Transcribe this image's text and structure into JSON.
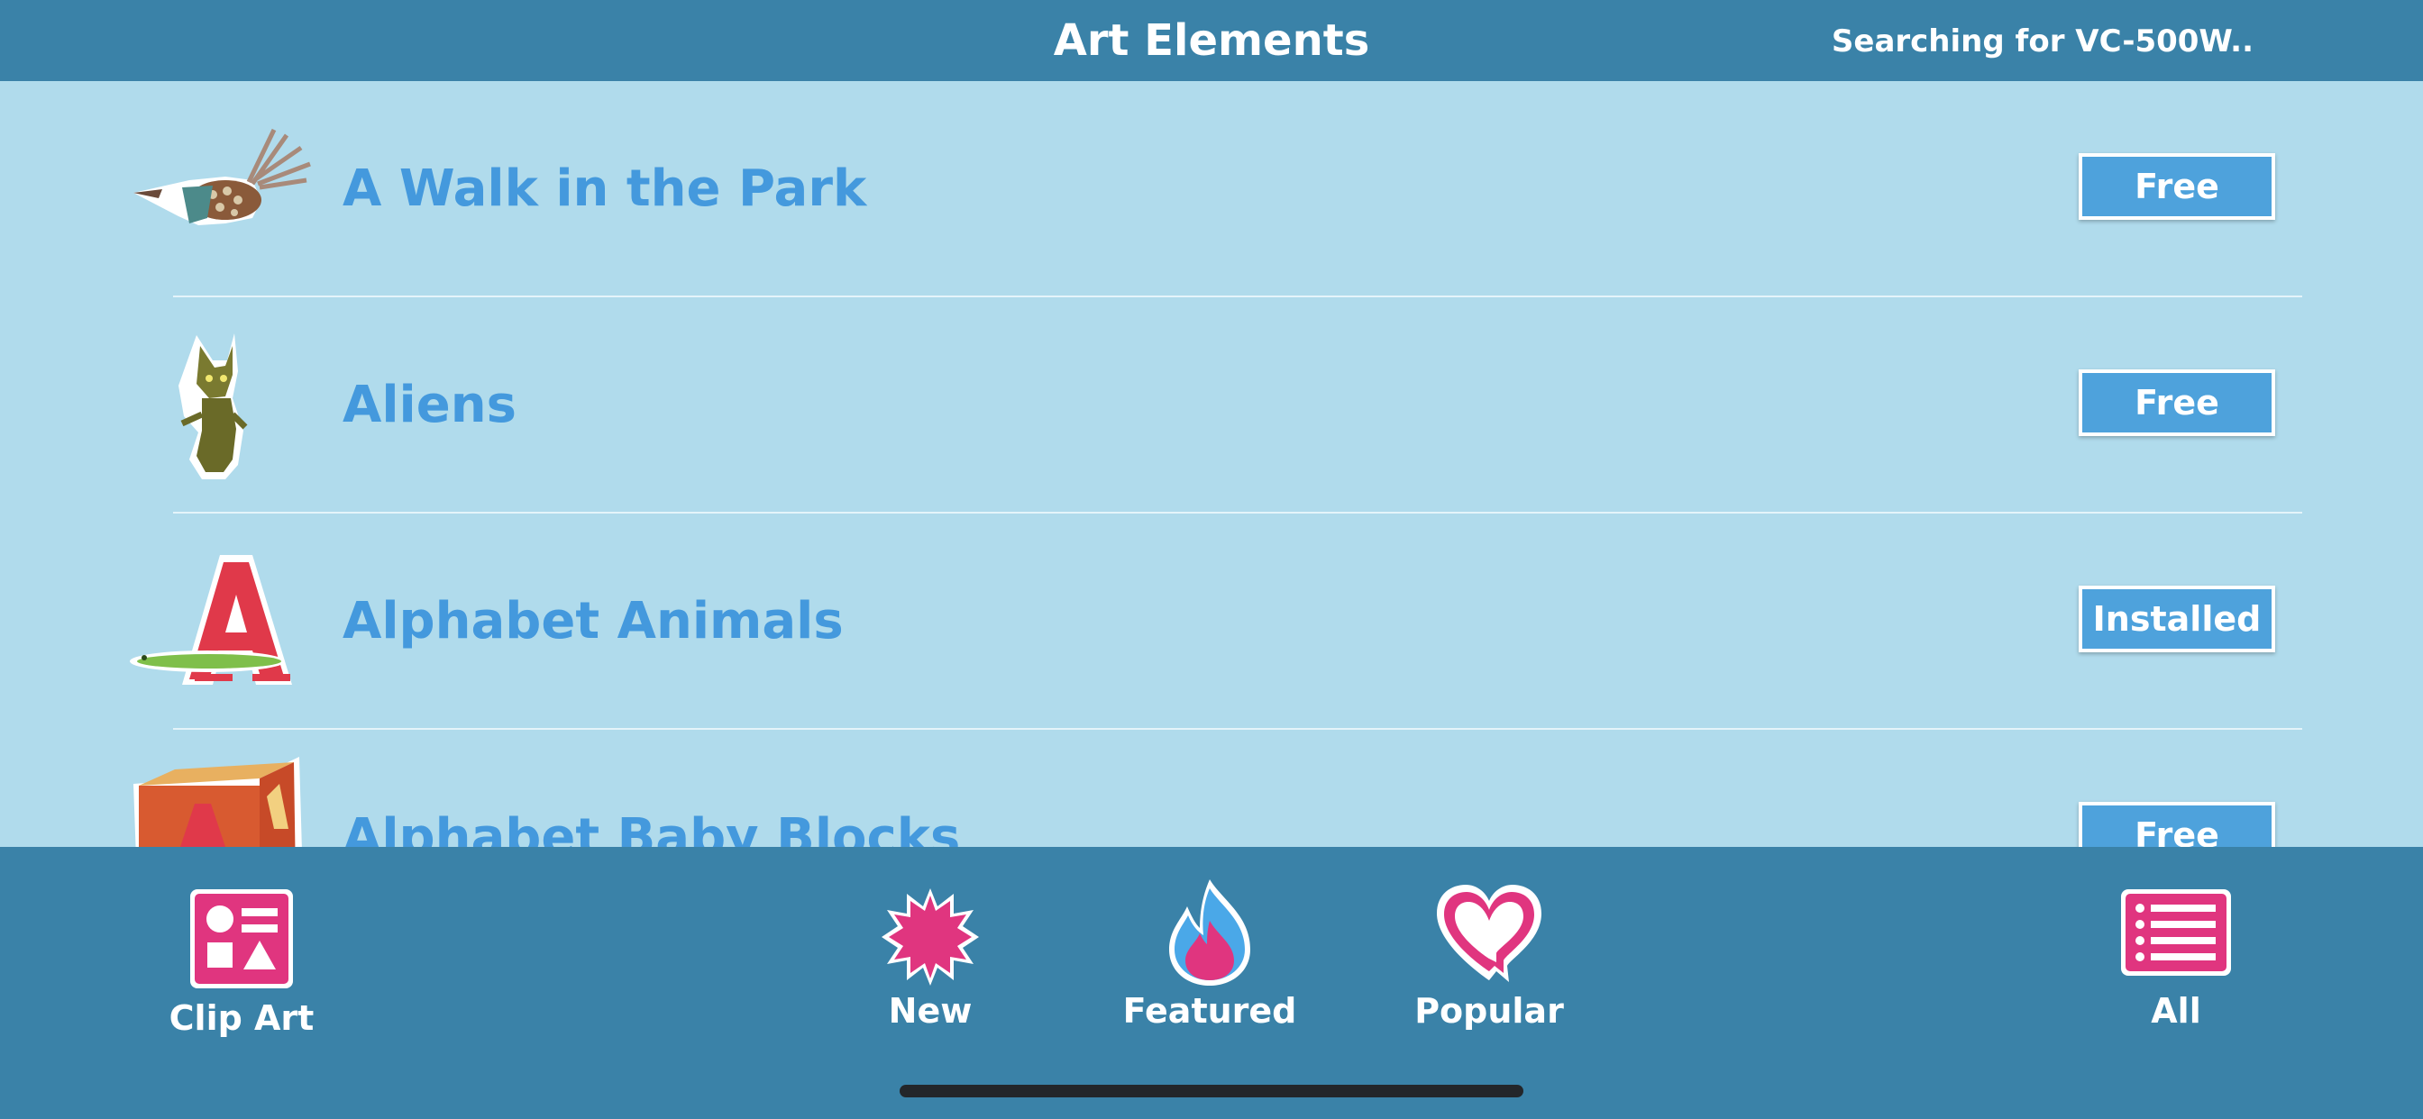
{
  "header": {
    "title": "Art Elements",
    "status": "Searching for VC-500W.."
  },
  "items": [
    {
      "label": "A Walk in the Park",
      "button": "Free",
      "thumb": "bird-thumbnail"
    },
    {
      "label": "Aliens",
      "button": "Free",
      "thumb": "alien-thumbnail"
    },
    {
      "label": "Alphabet Animals",
      "button": "Installed",
      "thumb": "letter-a-alligator-thumbnail"
    },
    {
      "label": "Alphabet Baby Blocks",
      "button": "Free",
      "thumb": "baby-block-thumbnail"
    }
  ],
  "tabs": [
    {
      "label": "Clip Art",
      "icon": "clip-art-icon"
    },
    {
      "label": "New",
      "icon": "new-starburst-icon"
    },
    {
      "label": "Featured",
      "icon": "flame-icon"
    },
    {
      "label": "Popular",
      "icon": "heart-icon"
    },
    {
      "label": "All",
      "icon": "list-icon"
    }
  ],
  "colors": {
    "header": "#3a82a8",
    "background": "#b0dbec",
    "accent": "#e0357f",
    "button": "#4ea2dc",
    "label": "#4499dd"
  }
}
